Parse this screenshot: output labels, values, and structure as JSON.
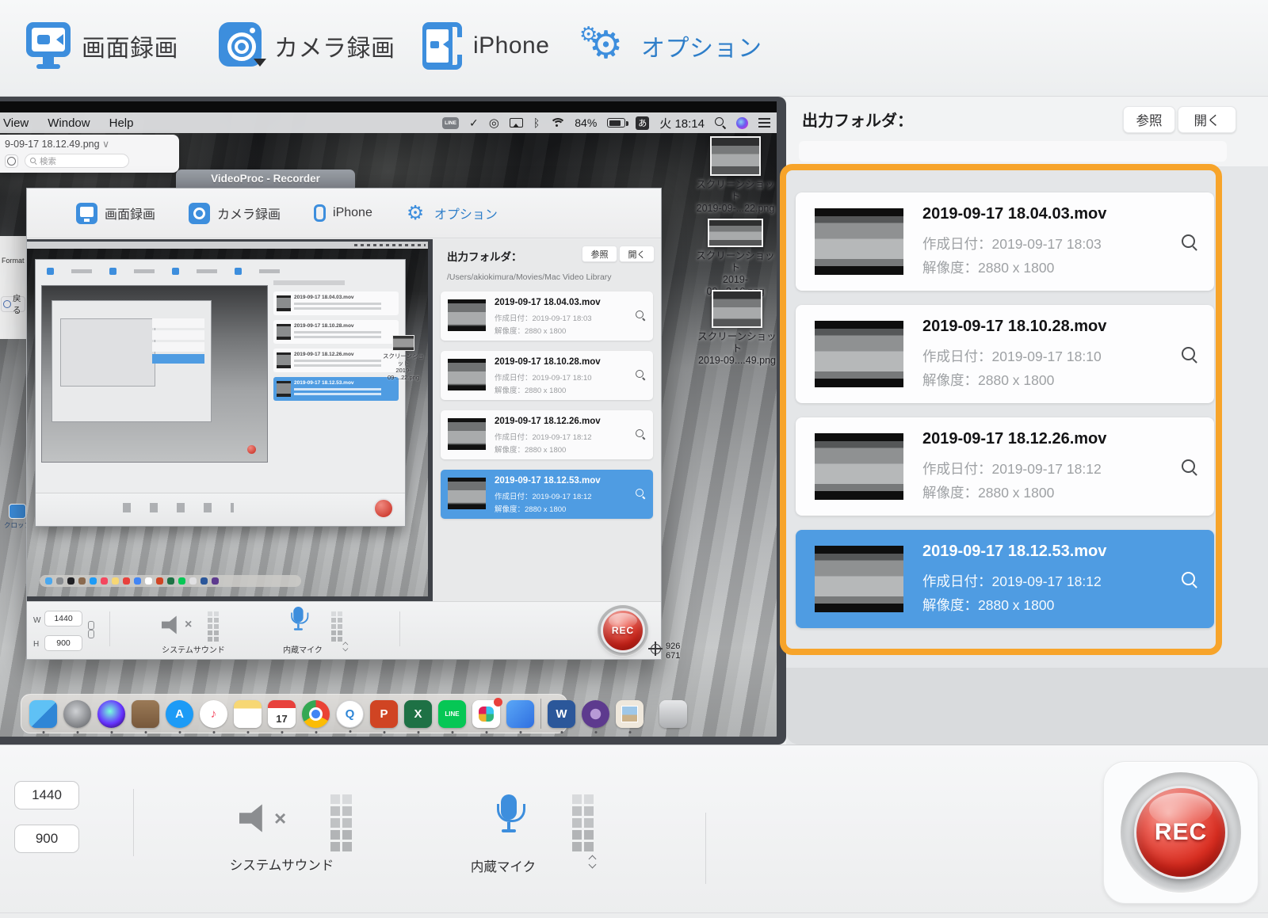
{
  "colors": {
    "accent_blue": "#3d8edd",
    "selection_blue": "#4f9ce2",
    "highlight_orange": "#f7a42a",
    "rec_red": "#da2f22"
  },
  "toolbar": {
    "screen_record": "画面録画",
    "camera_record": "カメラ録画",
    "iphone": "iPhone",
    "options": "オプション"
  },
  "output_panel": {
    "label": "出力フォルダ：",
    "browse": "参照",
    "open": "開く",
    "path": "/Users/akiokimura/Movies/Mac Video Library",
    "files": [
      {
        "name": "2019-09-17 18.04.03.mov",
        "created": "作成日付：2019-09-17 18:03",
        "resolution": "解像度：2880 x 1800",
        "selected": false
      },
      {
        "name": "2019-09-17 18.10.28.mov",
        "created": "作成日付：2019-09-17 18:10",
        "resolution": "解像度：2880 x 1800",
        "selected": false
      },
      {
        "name": "2019-09-17 18.12.26.mov",
        "created": "作成日付：2019-09-17 18:12",
        "resolution": "解像度：2880 x 1800",
        "selected": false
      },
      {
        "name": "2019-09-17 18.12.53.mov",
        "created": "作成日付：2019-09-17 18:12",
        "resolution": "解像度：2880 x 1800",
        "selected": true
      }
    ]
  },
  "bottom_bar": {
    "width_value": "1440",
    "height_value": "900",
    "system_sound_label": "システムサウンド",
    "mic_label": "内蔵マイク",
    "rec_label": "REC"
  },
  "desktop": {
    "menu_bar": {
      "menus": [
        "View",
        "Window",
        "Help"
      ],
      "battery": "84%",
      "input_source": "あ",
      "clock": "火 18:14",
      "line_badge": "LINE"
    },
    "preview_window": {
      "title": "9-09-17 18.12.49.png",
      "search_placeholder": "検索"
    },
    "icons": [
      {
        "line1": "スクリーンショット",
        "line2": "2019-09-...22.png"
      },
      {
        "line1": "スクリーンショット",
        "line2": "2019-09...2.16.png"
      },
      {
        "line1": "スクリーンショット",
        "line2": "2019-09....49.png"
      }
    ],
    "fragments": {
      "menu_text": "Format  View",
      "back_button": "戻る",
      "crop_label": "クロップ"
    },
    "dock": {
      "calendar_day": "17",
      "line_label": "LINE",
      "word": "W",
      "excel": "X",
      "powerpoint": "P",
      "quicktime": "Q",
      "appstore": "A"
    },
    "size_indicator": {
      "w": "926",
      "h": "671"
    }
  },
  "inner_window": {
    "title": "VideoProc - Recorder",
    "w_label": "W",
    "h_label": "H"
  }
}
